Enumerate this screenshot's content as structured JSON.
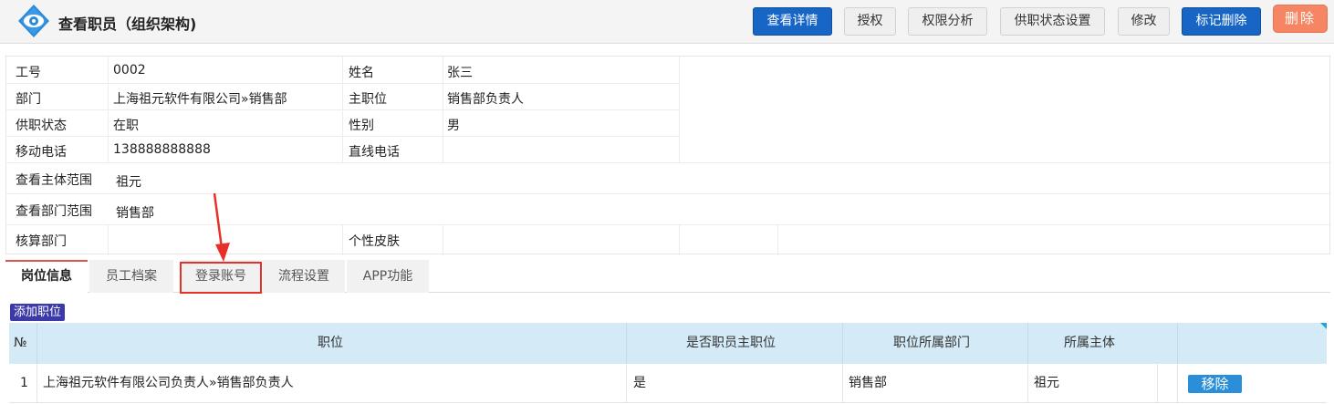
{
  "header": {
    "title": "查看职员（组织架构)",
    "buttons": {
      "view_details": "查看详情",
      "authorize": "授权",
      "permission_analysis": "权限分析",
      "employment_status_settings": "供职状态设置",
      "edit": "修改",
      "mark_delete": "标记删除",
      "delete": "删除"
    }
  },
  "employee": {
    "id_label": "工号",
    "id_value": "0002",
    "name_label": "姓名",
    "name_value": "张三",
    "dept_label": "部门",
    "dept_value": "上海祖元软件有限公司»销售部",
    "main_position_label": "主职位",
    "main_position_value": "销售部负责人",
    "status_label": "供职状态",
    "status_value": "在职",
    "gender_label": "性别",
    "gender_value": "男",
    "mobile_label": "移动电话",
    "mobile_value": "138888888888",
    "direct_phone_label": "直线电话",
    "direct_phone_value": "",
    "entity_scope_label": "查看主体范围",
    "entity_scope_value": "祖元",
    "dept_scope_label": "查看部门范围",
    "dept_scope_value": "销售部",
    "accounting_dept_label": "核算部门",
    "accounting_dept_value": "",
    "skin_label": "个性皮肤",
    "skin_value": ""
  },
  "tabs": [
    {
      "label": "岗位信息",
      "active": true
    },
    {
      "label": "员工档案",
      "active": false
    },
    {
      "label": "登录账号",
      "active": false
    },
    {
      "label": "流程设置",
      "active": false
    },
    {
      "label": "APP功能",
      "active": false
    }
  ],
  "positions": {
    "add_label": "添加职位",
    "columns": [
      "№",
      "职位",
      "是否职员主职位",
      "职位所属部门",
      "所属主体"
    ],
    "rows": [
      {
        "no": "1",
        "position": "上海祖元软件有限公司负责人»销售部负责人",
        "is_main": "是",
        "department": "销售部",
        "entity": "祖元",
        "action": "移除"
      }
    ]
  },
  "colors": {
    "primary": "#1766c5",
    "danger": "#f68663",
    "highlight": "#e8302a",
    "grid_header": "#d4eaf7",
    "remove_button": "#2a8fd8"
  }
}
